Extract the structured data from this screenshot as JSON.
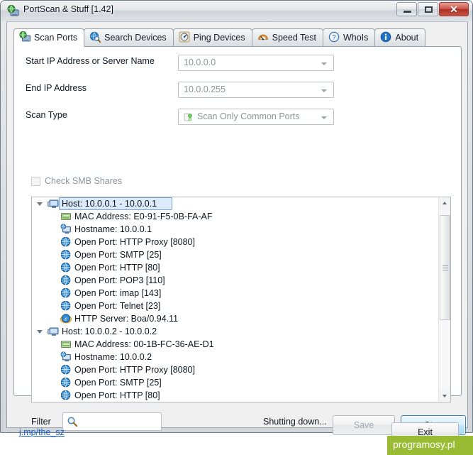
{
  "window": {
    "title": "PortScan & Stuff [1.42]",
    "icon": "app-globe-monitor-icon",
    "controls": {
      "minimize": "minimize-icon",
      "maximize": "maximize-icon",
      "close": "✕"
    }
  },
  "tabs": [
    {
      "label": "Scan Ports",
      "icon": "monitor-globe-icon",
      "active": true
    },
    {
      "label": "Search Devices",
      "icon": "globe-search-icon",
      "active": false
    },
    {
      "label": "Ping Devices",
      "icon": "gauge-icon",
      "active": false
    },
    {
      "label": "Speed Test",
      "icon": "speedometer-icon",
      "active": false
    },
    {
      "label": "WhoIs",
      "icon": "question-circle-icon",
      "active": false
    },
    {
      "label": "About",
      "icon": "info-circle-icon",
      "active": false
    }
  ],
  "form": {
    "start_ip": {
      "label": "Start IP Address or Server Name",
      "value": "10.0.0.0"
    },
    "end_ip": {
      "label": "End IP Address",
      "value": "10.0.0.255"
    },
    "scan_type": {
      "label": "Scan Type",
      "value": "Scan Only Common Ports",
      "icon": "ports-green-dot-icon"
    },
    "smb": {
      "label": "Check SMB Shares",
      "checked": false
    }
  },
  "tree": {
    "nodes": [
      {
        "level": "host",
        "icon": "computer-icon",
        "label": "Host: 10.0.0.1 - 10.0.0.1",
        "selected": true,
        "expanded": true
      },
      {
        "level": "child",
        "icon": "mac-card-icon",
        "label": "MAC Address: E0-91-F5-0B-FA-AF"
      },
      {
        "level": "child",
        "icon": "hostname-icon",
        "label": "Hostname: 10.0.0.1"
      },
      {
        "level": "child",
        "icon": "port-globe-icon",
        "label": "Open Port: HTTP Proxy [8080]"
      },
      {
        "level": "child",
        "icon": "port-globe-icon",
        "label": "Open Port: SMTP [25]"
      },
      {
        "level": "child",
        "icon": "port-globe-icon",
        "label": "Open Port: HTTP [80]"
      },
      {
        "level": "child",
        "icon": "port-globe-icon",
        "label": "Open Port: POP3 [110]"
      },
      {
        "level": "child",
        "icon": "port-globe-icon",
        "label": "Open Port: imap [143]"
      },
      {
        "level": "child",
        "icon": "port-globe-icon",
        "label": "Open Port: Telnet [23]"
      },
      {
        "level": "child",
        "icon": "browser-e-icon",
        "label": "HTTP Server: Boa/0.94.11"
      },
      {
        "level": "host",
        "icon": "computer-icon",
        "label": "Host: 10.0.0.2 - 10.0.0.2",
        "selected": false,
        "expanded": true
      },
      {
        "level": "child",
        "icon": "mac-card-icon",
        "label": "MAC Address: 00-1B-FC-36-AE-D1"
      },
      {
        "level": "child",
        "icon": "hostname-icon",
        "label": "Hostname: 10.0.0.2"
      },
      {
        "level": "child",
        "icon": "port-globe-icon",
        "label": "Open Port: HTTP Proxy [8080]"
      },
      {
        "level": "child",
        "icon": "port-globe-icon",
        "label": "Open Port: SMTP [25]"
      },
      {
        "level": "child",
        "icon": "port-globe-icon",
        "label": "Open Port: HTTP [80]"
      }
    ]
  },
  "bottom": {
    "filter_label": "Filter",
    "filter_value": "",
    "filter_icon": "magnifier-icon",
    "status": "Shutting down...",
    "save_label": "Save",
    "save_enabled": false,
    "stop_label": "Stop"
  },
  "footer": {
    "link": "j.mp/the_sz",
    "exit_label": "Exit",
    "watermark": "programosy.pl",
    "watermark_color": "#99bb33"
  }
}
